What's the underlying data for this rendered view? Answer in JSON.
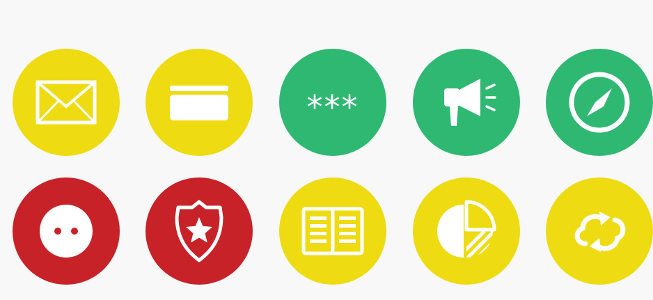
{
  "colors": {
    "background": "#f8f8f8",
    "yellow": "#eedb12",
    "green": "#2fb872",
    "red": "#c72228",
    "glyph": "#ffffff"
  },
  "rows": [
    [
      {
        "icon": "envelope-icon",
        "color": "yellow"
      },
      {
        "icon": "card-icon",
        "color": "yellow"
      },
      {
        "icon": "password-icon",
        "color": "green",
        "text": "***"
      },
      {
        "icon": "megaphone-icon",
        "color": "green"
      },
      {
        "icon": "compass-icon",
        "color": "green"
      }
    ],
    [
      {
        "icon": "socket-icon",
        "color": "red"
      },
      {
        "icon": "police-badge-icon",
        "color": "red"
      },
      {
        "icon": "open-book-icon",
        "color": "yellow"
      },
      {
        "icon": "pie-chart-icon",
        "color": "yellow"
      },
      {
        "icon": "cloud-sync-icon",
        "color": "yellow"
      }
    ]
  ]
}
